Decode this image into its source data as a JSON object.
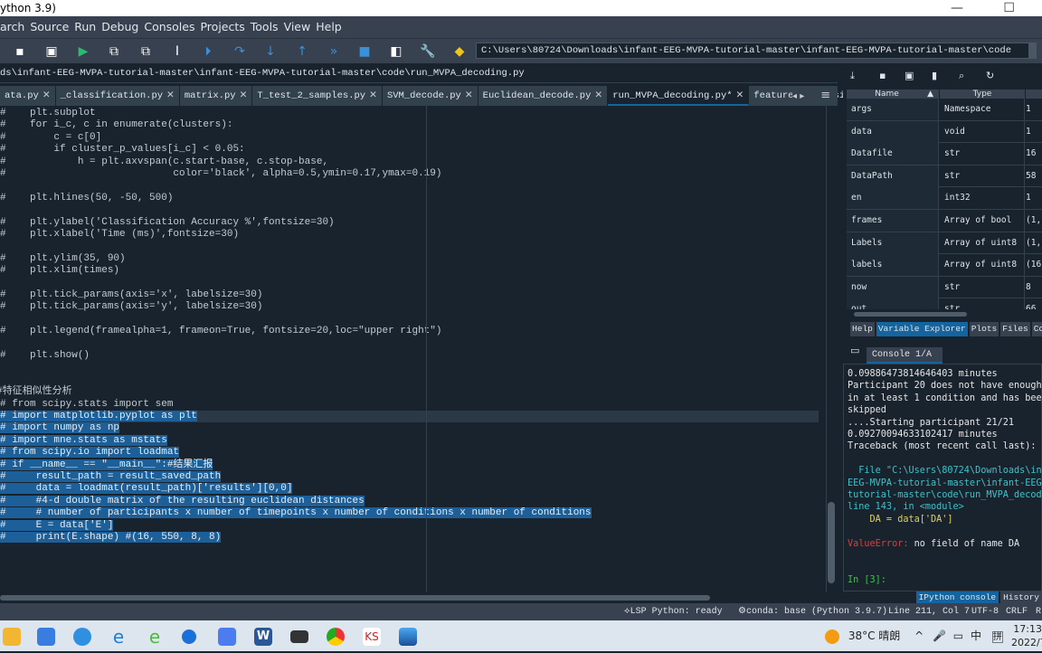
{
  "window": {
    "title": "ython 3.9)",
    "controls": "— ☐"
  },
  "menu": [
    "arch",
    "Source",
    "Run",
    "Debug",
    "Consoles",
    "Projects",
    "Tools",
    "View",
    "Help"
  ],
  "toolbar": {
    "cwd": "C:\\Users\\80724\\Downloads\\infant-EEG-MVPA-tutorial-master\\infant-EEG-MVPA-tutorial-master\\code"
  },
  "editor": {
    "path": "ds\\infant-EEG-MVPA-tutorial-master\\infant-EEG-MVPA-tutorial-master\\code\\run_MVPA_decoding.py",
    "tabs": [
      "ata.py",
      "_classification.py",
      "matrix.py",
      "T_test_2_samples.py",
      "SVM_decode.py",
      "Euclidean_decode.py",
      "run_MVPA_decoding.py*",
      "feature_sel_basic_data.py"
    ],
    "active_tab": 6,
    "lines": [
      "#    plt.subplot",
      "#    for i_c, c in enumerate(clusters):",
      "#        c = c[0]",
      "#        if cluster_p_values[i_c] < 0.05:",
      "#            h = plt.axvspan(c.start-base, c.stop-base,",
      "#                            color='black', alpha=0.5,ymin=0.17,ymax=0.19)",
      "",
      "#    plt.hlines(50, -50, 500)",
      "",
      "#    plt.ylabel('Classification Accuracy %',fontsize=30)",
      "#    plt.xlabel('Time (ms)',fontsize=30)",
      "",
      "#    plt.ylim(35, 90)",
      "#    plt.xlim(times)",
      "",
      "#    plt.tick_params(axis='x', labelsize=30)",
      "#    plt.tick_params(axis='y', labelsize=30)",
      "",
      "#    plt.legend(framealpha=1, frameon=True, fontsize=20,loc=\"upper right\")",
      "",
      "#    plt.show()",
      "",
      "",
      "#特征相似性分析",
      "# from scipy.stats import sem",
      "# import matplotlib.pyplot as plt",
      "# import numpy as np",
      "# import mne.stats as mstats",
      "# from scipy.io import loadmat",
      "# if __name__ == \"__main__\":#结果汇报",
      "#     result_path = result_saved_path",
      "#     data = loadmat(result_path)['results'][0,0]",
      "#     #4-d double matrix of the resulting euclidean distances",
      "#     # number of participants x number of timepoints x number of conditions x number of conditions",
      "#     E = data['E']",
      "#     print(E.shape) #(16, 550, 8, 8)"
    ]
  },
  "variable_explorer": {
    "columns": [
      "Name",
      "Type"
    ],
    "rows": [
      [
        "args",
        "Namespace",
        "1"
      ],
      [
        "data",
        "void",
        "1"
      ],
      [
        "Datafile",
        "str",
        "16"
      ],
      [
        "DataPath",
        "str",
        "58"
      ],
      [
        "en",
        "int32",
        "1"
      ],
      [
        "frames",
        "Array of bool",
        "(1,"
      ],
      [
        "Labels",
        "Array of uint8",
        "(1,"
      ],
      [
        "labels",
        "Array of uint8",
        "(16"
      ],
      [
        "now",
        "str",
        "8"
      ],
      [
        "out",
        "str",
        "66"
      ]
    ],
    "tabs": [
      "Help",
      "Variable Explorer",
      "Plots",
      "Files",
      "Cod"
    ],
    "active_tab": 1
  },
  "console": {
    "tab": "Console 1/A",
    "lines": [
      {
        "t": "0.09886473814646403 minutes",
        "c": "#e6e6e6"
      },
      {
        "t": "Participant 20 does not have enough",
        "c": "#e6e6e6"
      },
      {
        "t": "in at least 1 condition and has been",
        "c": "#e6e6e6"
      },
      {
        "t": "skipped",
        "c": "#e6e6e6"
      },
      {
        "t": "....Starting participant 21/21",
        "c": "#e6e6e6"
      },
      {
        "t": "0.09270094633102417 minutes",
        "c": "#e6e6e6"
      },
      {
        "t": "Traceback (most recent call last):",
        "c": "#e6e6e6"
      },
      {
        "t": "",
        "c": "#e6e6e6"
      },
      {
        "t": "  File \"C:\\Users\\80724\\Downloads\\inf",
        "c": "#3fc1c9"
      },
      {
        "t": "EEG-MVPA-tutorial-master\\infant-EEG-",
        "c": "#3fc1c9"
      },
      {
        "t": "tutorial-master\\code\\run_MVPA_decodi",
        "c": "#3fc1c9"
      },
      {
        "t": "line 143, in <module>",
        "c": "#3fc1c9"
      },
      {
        "t": "    DA = data['DA']",
        "c": "#e0d25a"
      },
      {
        "t": "",
        "c": "#e6e6e6"
      },
      {
        "t": "ValueError: no field of name DA",
        "c": "#e6e6e6"
      },
      {
        "t": "",
        "c": "#e6e6e6"
      },
      {
        "t": "",
        "c": "#e6e6e6"
      },
      {
        "t": "In [3]:",
        "c": "#3fc14a"
      }
    ],
    "bottom_tabs": [
      "IPython console",
      "History"
    ]
  },
  "status": {
    "lsp": "LSP Python: ready",
    "conda": "conda: base (Python 3.9.7)",
    "position": "Line 211, Col 7",
    "encoding": "UTF-8",
    "eol": "CRLF",
    "extra": "R"
  },
  "taskbar": {
    "weather": "38°C 晴朗",
    "ime": "中",
    "ime2": "拼",
    "time": "17:13",
    "date": "2022/7"
  }
}
